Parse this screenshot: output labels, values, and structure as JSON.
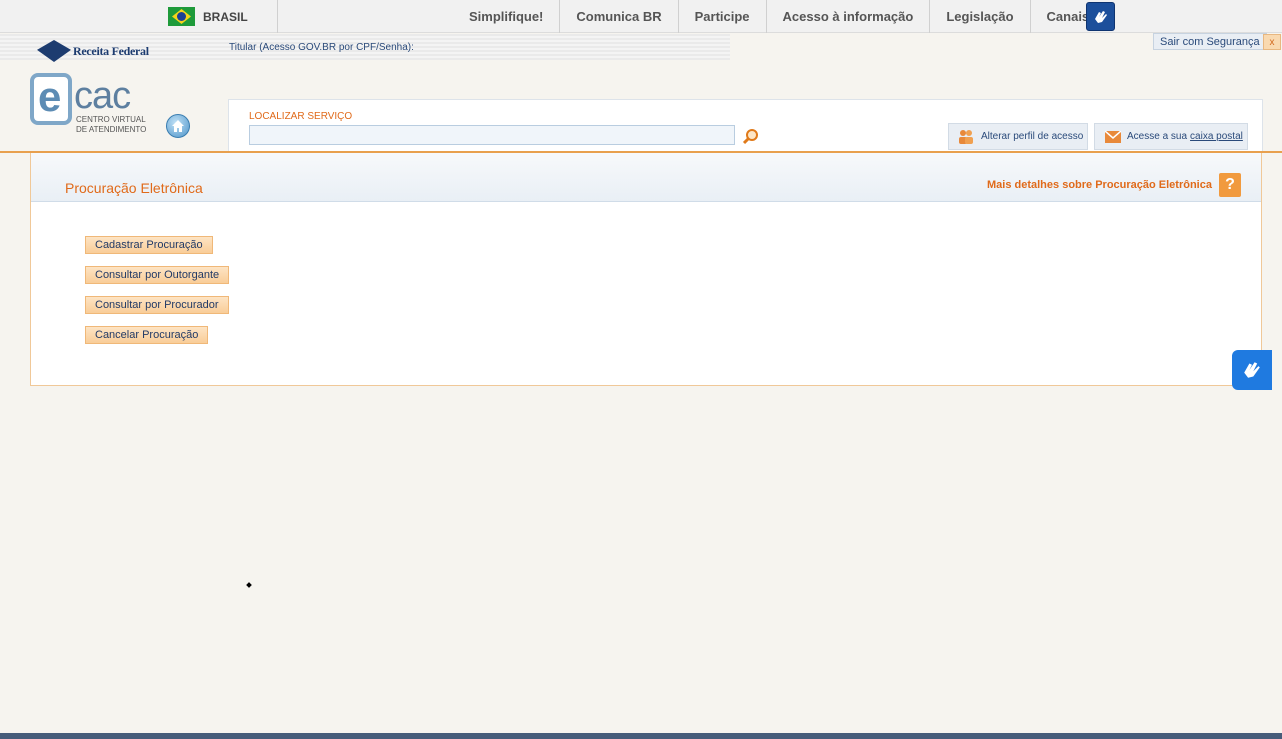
{
  "gov_bar": {
    "country": "BRASIL",
    "nav": [
      "Simplifique!",
      "Comunica BR",
      "Participe",
      "Acesso à informação",
      "Legislação",
      "Canais"
    ]
  },
  "header": {
    "brand": "Receita Federal",
    "titular": "Titular (Acesso GOV.BR por CPF/Senha):",
    "logout": "Sair com Segurança",
    "logout_close": "x",
    "ecac_e": "e",
    "ecac_cac": "cac",
    "ecac_sub1": "CENTRO VIRTUAL",
    "ecac_sub2": "DE ATENDIMENTO"
  },
  "search": {
    "label": "LOCALIZAR SERVIÇO",
    "value": "",
    "perfil": "Alterar perfil de acesso",
    "caixa_prefix": "Acesse a sua",
    "caixa_link": "caixa postal"
  },
  "content": {
    "title": "Procuração Eletrônica",
    "details": "Mais detalhes sobre Procuração Eletrônica",
    "help": "?",
    "actions": [
      "Cadastrar Procuração",
      "Consultar por Outorgante",
      "Consultar por Procurador",
      "Cancelar Procuração"
    ]
  },
  "colors": {
    "accent": "#e06a1a",
    "libras": "#1f7ae0"
  }
}
